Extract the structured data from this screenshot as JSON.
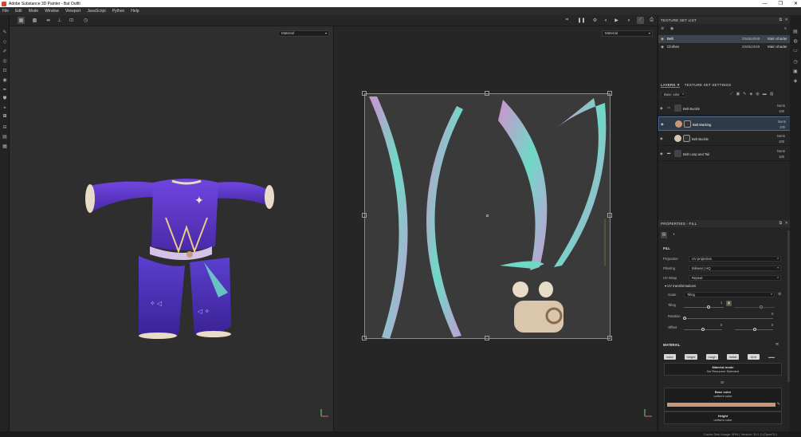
{
  "window": {
    "title": "Adobe Substance 3D Painter - Bat Outfit",
    "controls": [
      "—",
      "❐",
      "✕"
    ]
  },
  "menu": [
    "File",
    "Edit",
    "Mode",
    "Window",
    "Viewport",
    "JavaScript",
    "Python",
    "Help"
  ],
  "viewport": {
    "left_select": "Material",
    "right_select": "Material"
  },
  "texture_set_list": {
    "title": "TEXTURE SET LIST",
    "rows": [
      {
        "name": "Belt",
        "size": "2048x2048",
        "shader": "Main shader"
      },
      {
        "name": "Clothes",
        "size": "2048x2048",
        "shader": "Main shader"
      }
    ]
  },
  "layers": {
    "tabs": [
      "LAYERS",
      "TEXTURE SET SETTINGS"
    ],
    "channel_select": "Base color",
    "rows": [
      {
        "name": "Belt Buckle",
        "blend": "Norm",
        "opacity": "100"
      },
      {
        "name": "Belt Marking",
        "blend": "Norm",
        "opacity": "100"
      },
      {
        "name": "Belt Buckle",
        "blend": "Norm",
        "opacity": "100"
      },
      {
        "name": "Belt Loop and Tail",
        "blend": "Norm",
        "opacity": "100"
      }
    ]
  },
  "properties": {
    "title": "PROPERTIES - FILL",
    "fill_section": "FILL",
    "projection_label": "Projection",
    "projection_value": "UV projection",
    "filtering_label": "Filtering",
    "filtering_value": "Bilinear | HQ",
    "uvwrap_label": "UV Wrap",
    "uvwrap_value": "Repeat",
    "uvtrans_label": "UV transformations",
    "scale_label": "Scale",
    "scale_value": "Tiling",
    "tiling_label": "Tiling",
    "tiling_value": "1",
    "rotation_label": "Rotation",
    "rotation_value": "0",
    "offset_label": "Offset",
    "offset_x": "0",
    "offset_y": "0",
    "material_section": "MATERIAL",
    "channels": [
      "color",
      "height",
      "rough",
      "metal",
      "nrm"
    ],
    "material_mode_label": "Material mode",
    "material_mode_value": "No Resource Selected",
    "or_text": "Or",
    "base_color_label": "Base color",
    "base_color_sub": "uniform color",
    "base_color_hex": "#c9967a",
    "height_label": "Height",
    "height_sub": "uniform color"
  },
  "status": {
    "text": "Cache Disk Usage:  90% | Version: 10.1.2 (OpenGL)"
  },
  "colors": {
    "accent": "#4c6a8e",
    "outfit_purple": "#6a3fd6",
    "uv_teal": "#6fd9c6",
    "uv_pink": "#d38fd0"
  }
}
